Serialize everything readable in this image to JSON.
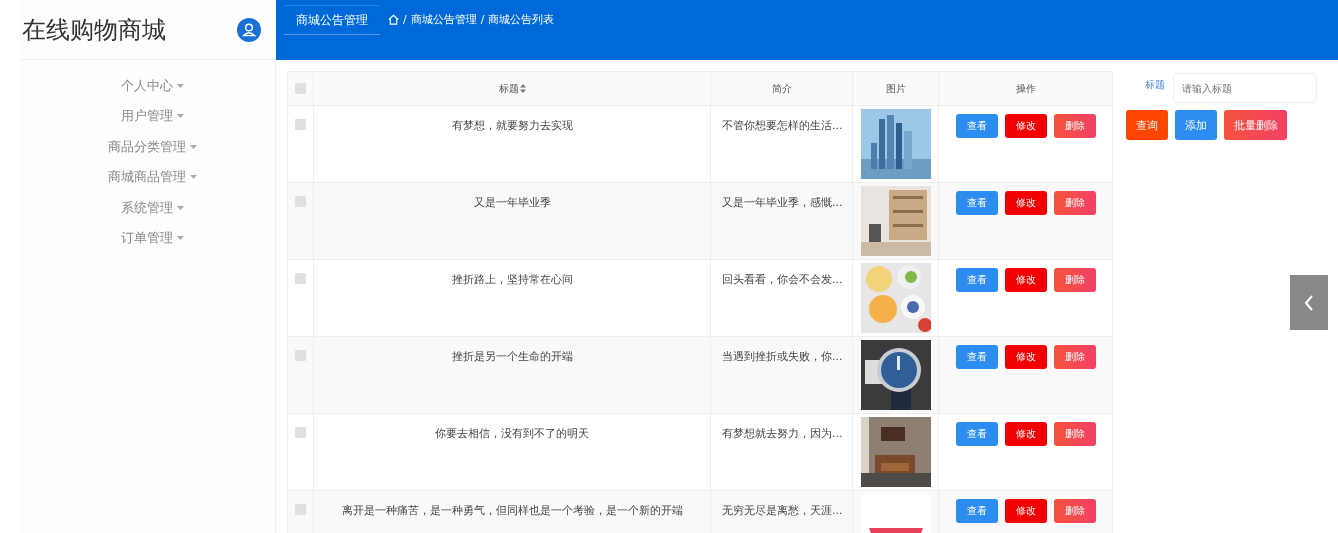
{
  "app": {
    "title": "在线购物商城"
  },
  "sidebar": {
    "items": [
      {
        "label": "个人中心"
      },
      {
        "label": "用户管理"
      },
      {
        "label": "商品分类管理"
      },
      {
        "label": "商城商品管理"
      },
      {
        "label": "系统管理"
      },
      {
        "label": "订单管理"
      }
    ]
  },
  "header": {
    "tab": "商城公告管理",
    "breadcrumb": [
      "商城公告管理",
      "商城公告列表"
    ],
    "separator": "/"
  },
  "table": {
    "all_checked": false,
    "columns": [
      "标题",
      "简介",
      "图片",
      "操作"
    ],
    "rows": [
      {
        "checked": false,
        "title": "有梦想，就要努力去实现",
        "intro": "不管你想要怎样的生活...",
        "actions": [
          {
            "kind": "view",
            "label": "查看"
          },
          {
            "kind": "edit",
            "label": "修改"
          },
          {
            "kind": "delete",
            "label": "删除"
          }
        ]
      },
      {
        "checked": false,
        "title": "又是一年毕业季",
        "intro": "又是一年毕业季，感慨...",
        "actions": [
          {
            "kind": "view",
            "label": "查看"
          },
          {
            "kind": "edit",
            "label": "修改"
          },
          {
            "kind": "delete",
            "label": "删除"
          }
        ]
      },
      {
        "checked": false,
        "title": "挫折路上，坚持常在心间",
        "intro": "回头看看，你会不会发...",
        "actions": [
          {
            "kind": "view",
            "label": "查看"
          },
          {
            "kind": "edit",
            "label": "修改"
          },
          {
            "kind": "delete",
            "label": "删除"
          }
        ]
      },
      {
        "checked": false,
        "title": "挫折是另一个生命的开端",
        "intro": "当遇到挫折或失败，你...",
        "actions": [
          {
            "kind": "view",
            "label": "查看"
          },
          {
            "kind": "edit",
            "label": "修改"
          },
          {
            "kind": "delete",
            "label": "删除"
          }
        ]
      },
      {
        "checked": false,
        "title": "你要去相信，没有到不了的明天",
        "intro": "有梦想就去努力，因为...",
        "actions": [
          {
            "kind": "view",
            "label": "查看"
          },
          {
            "kind": "edit",
            "label": "修改"
          },
          {
            "kind": "delete",
            "label": "删除"
          }
        ]
      },
      {
        "checked": false,
        "title": "离开是一种痛苦，是一种勇气，但同样也是一个考验，是一个新的开端",
        "intro": "无穷无尽是离愁，天涯...",
        "actions": [
          {
            "kind": "view",
            "label": "查看"
          },
          {
            "kind": "edit",
            "label": "修改"
          },
          {
            "kind": "delete",
            "label": "删除"
          }
        ]
      }
    ]
  },
  "search": {
    "label": "标题",
    "placeholder": "请输入标题",
    "buttons": [
      {
        "kind": "search",
        "label": "查询"
      },
      {
        "kind": "add",
        "label": "添加"
      },
      {
        "kind": "batch-delete",
        "label": "批量删除"
      }
    ]
  }
}
